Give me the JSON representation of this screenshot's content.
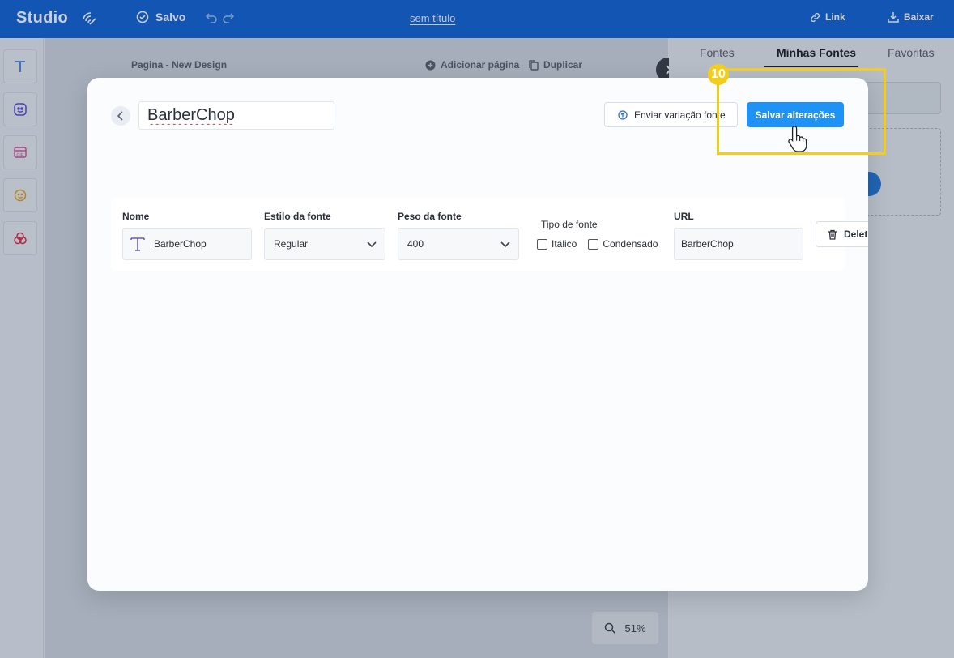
{
  "topbar": {
    "logo": "Studio",
    "saved_label": "Salvo",
    "doc_title": "sem título",
    "link_label": "Link",
    "download_label": "Baixar"
  },
  "canvas": {
    "page_label": "Pagina - New Design",
    "add_page_label": "Adicionar página",
    "duplicate_label": "Duplicar",
    "zoom": "51%"
  },
  "right_panel": {
    "tabs": [
      {
        "label": "Fontes"
      },
      {
        "label": "Minhas Fontes",
        "active": true
      },
      {
        "label": "Favoritas"
      }
    ]
  },
  "modal": {
    "font_name_value": "BarberChop",
    "send_variation_label": "Enviar variação fonte",
    "save_label": "Salvar alterações",
    "row": {
      "name_label": "Nome",
      "name_value": "BarberChop",
      "style_label": "Estilo da fonte",
      "style_value": "Regular",
      "weight_label": "Peso da fonte",
      "weight_value": "400",
      "type_label": "Tipo de fonte",
      "italic_label": "Itálico",
      "condensed_label": "Condensado",
      "url_label": "URL",
      "url_value": "BarberChop",
      "delete_label": "Delet"
    }
  },
  "step": {
    "number": "10"
  },
  "colors": {
    "topbar": "#1364d6",
    "primary_button": "#1e93f5",
    "highlight": "#f2cd1d"
  }
}
